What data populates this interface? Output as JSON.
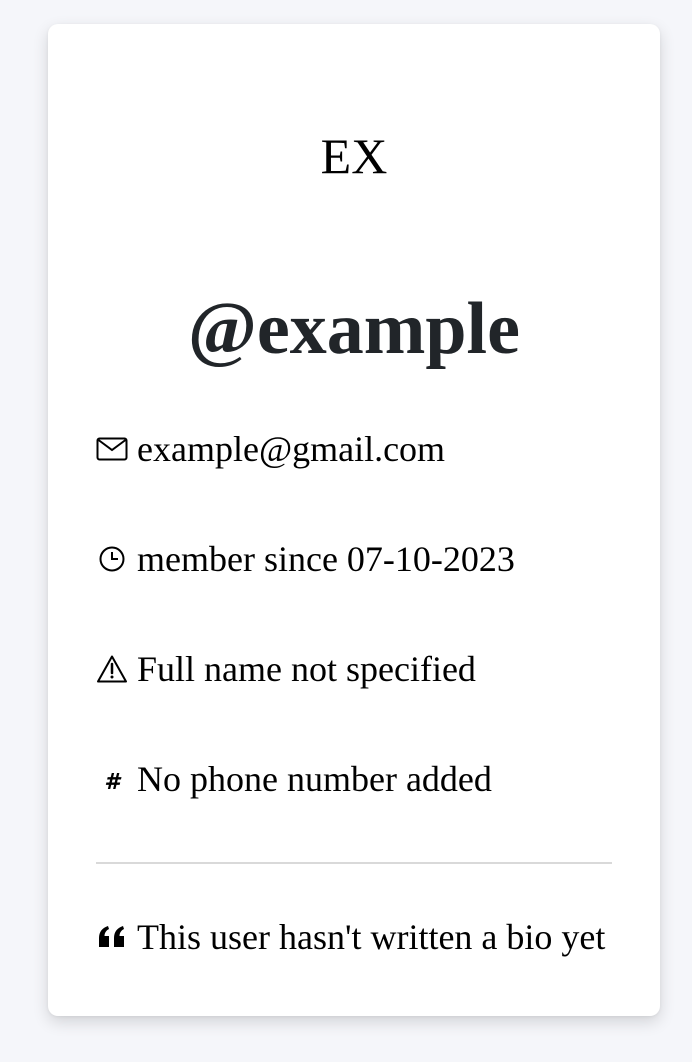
{
  "profile": {
    "initials": "EX",
    "username": "@example",
    "email": "example@gmail.com",
    "member_since": "member since 07-10-2023",
    "full_name_status": "Full name not specified",
    "phone_status": "No phone number added",
    "bio": "This user hasn't written a bio yet"
  },
  "icons": {
    "email": "envelope-icon",
    "member_since": "clock-icon",
    "full_name": "warning-triangle-icon",
    "phone": "hash-icon",
    "bio": "quote-icon"
  }
}
